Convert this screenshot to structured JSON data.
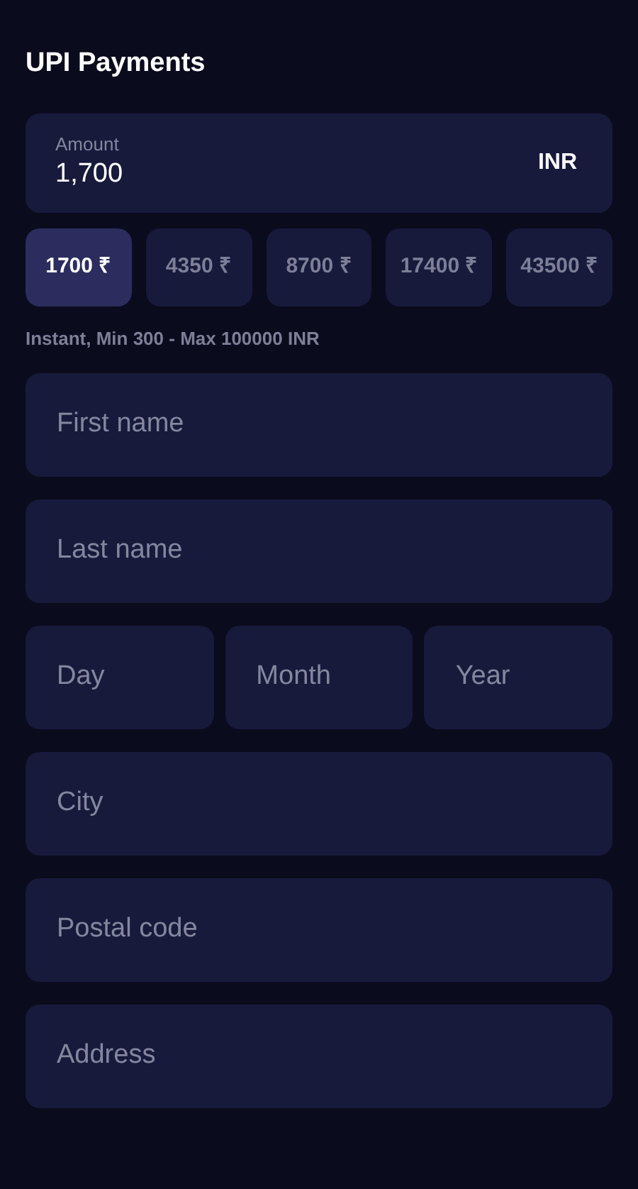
{
  "title": "UPI Payments",
  "amount": {
    "label": "Amount",
    "value": "1,700",
    "currency": "INR"
  },
  "presets": [
    {
      "label": "1700 ₹",
      "selected": true
    },
    {
      "label": "4350 ₹",
      "selected": false
    },
    {
      "label": "8700 ₹",
      "selected": false
    },
    {
      "label": "17400 ₹",
      "selected": false
    },
    {
      "label": "43500 ₹",
      "selected": false
    }
  ],
  "hint": "Instant, Min 300 - Max 100000 INR",
  "fields": [
    {
      "placeholder": "First name"
    },
    {
      "placeholder": "Last name"
    },
    {
      "kind": "row",
      "items": [
        {
          "placeholder": "Day"
        },
        {
          "placeholder": "Month"
        },
        {
          "placeholder": "Year"
        }
      ]
    },
    {
      "placeholder": "City"
    },
    {
      "placeholder": "Postal code"
    },
    {
      "placeholder": "Address"
    }
  ]
}
